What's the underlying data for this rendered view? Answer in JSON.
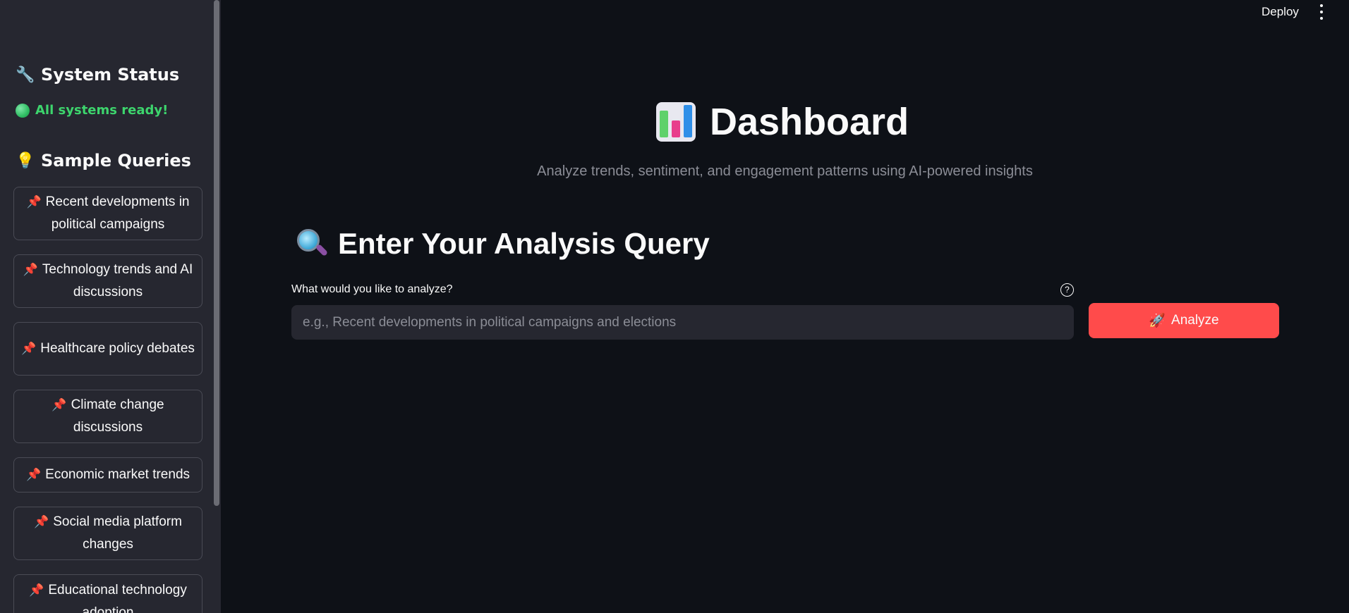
{
  "header": {
    "deploy_label": "Deploy",
    "menu_icon": "kebab-menu-icon"
  },
  "sidebar": {
    "system_status": {
      "icon": "wrench-icon",
      "title": "System Status",
      "status_text": "All systems ready!",
      "status_color": "#3dd56d"
    },
    "sample_queries": {
      "icon": "lightbulb-icon",
      "title": "Sample Queries",
      "items": [
        {
          "label": "Recent developments in political campaigns"
        },
        {
          "label": "Technology trends and AI discussions"
        },
        {
          "label": "Healthcare policy debates"
        },
        {
          "label": "Climate change discussions"
        },
        {
          "label": "Economic market trends"
        },
        {
          "label": "Social media platform changes"
        },
        {
          "label": "Educational technology adoption"
        }
      ]
    }
  },
  "main": {
    "title": "Dashboard",
    "title_icon": "bar-chart-icon",
    "subtitle": "Analyze trends, sentiment, and engagement patterns using AI-powered insights",
    "query_section": {
      "icon": "magnifying-glass-icon",
      "heading": "Enter Your Analysis Query",
      "input_label": "What would you like to analyze?",
      "input_placeholder": "e.g., Recent developments in political campaigns and elections",
      "input_value": "",
      "analyze_label": "Analyze",
      "analyze_icon": "rocket-icon",
      "accent_color": "#ff4b4b"
    }
  }
}
